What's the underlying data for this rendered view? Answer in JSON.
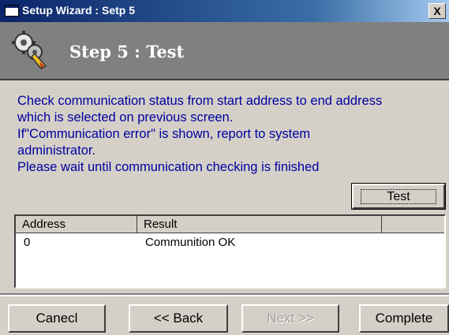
{
  "window": {
    "title": "Setup Wizard : Setp 5",
    "close_label": "X"
  },
  "header": {
    "step_title": "Step 5 : Test"
  },
  "instructions": {
    "line1": "Check communication status from start address to end address",
    "line2": "which is selected on previous screen.",
    "line3": "If\"Communication error\" is shown, report to system",
    "line4": "administrator.",
    "line5": "Please wait until communication checking is finished"
  },
  "test_button": {
    "label": "Test"
  },
  "table": {
    "columns": [
      "Address",
      "Result",
      ""
    ],
    "rows": [
      {
        "address": "0",
        "result": "Communition OK"
      }
    ]
  },
  "footer": {
    "cancel_label": "Canecl",
    "back_label": "<< Back",
    "next_label": "Next >>",
    "complete_label": "Complete"
  }
}
